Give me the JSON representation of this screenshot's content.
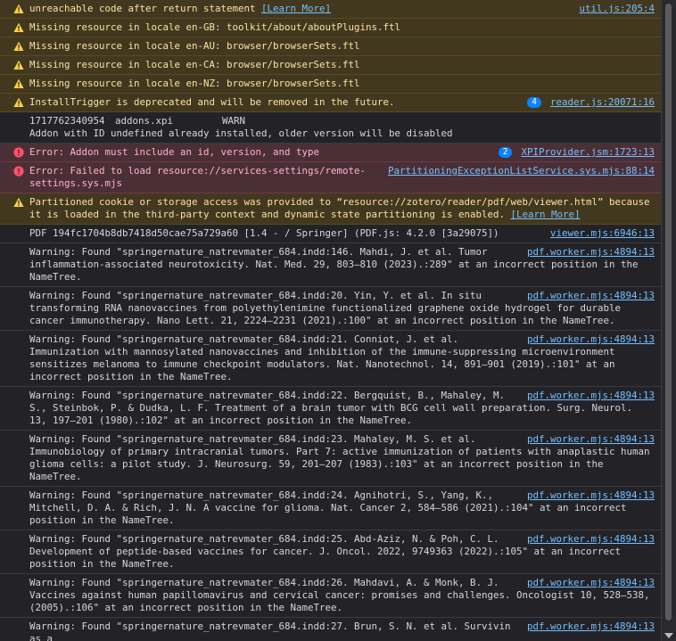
{
  "messages": [
    {
      "level": "warn",
      "text": "unreachable code after return statement",
      "link": "[Learn More]",
      "source": "util.js:205:4"
    },
    {
      "level": "warn",
      "text": "Missing resource in locale en-GB: toolkit/about/aboutPlugins.ftl"
    },
    {
      "level": "warn",
      "text": "Missing resource in locale en-AU: browser/browserSets.ftl"
    },
    {
      "level": "warn",
      "text": "Missing resource in locale en-CA: browser/browserSets.ftl"
    },
    {
      "level": "warn",
      "text": "Missing resource in locale en-NZ: browser/browserSets.ftl"
    },
    {
      "level": "warn",
      "text": "InstallTrigger is deprecated and will be removed in the future.",
      "badge": "4",
      "source": "reader.js:20071:16"
    },
    {
      "level": "log",
      "raw": true,
      "c1": "1717762340954",
      "c2": "addons.xpi",
      "c3": "WARN",
      "c4": "Addon with ID undefined already installed, older version will be disabled"
    },
    {
      "level": "error",
      "text": "Error: Addon must include an id, version, and type",
      "badge": "2",
      "source": "XPIProvider.jsm:1723:13"
    },
    {
      "level": "error",
      "text": "Error: Failed to load resource://services-settings/remote-settings.sys.mjs",
      "source": "PartitioningExceptionListService.sys.mjs:88:14"
    },
    {
      "level": "warn",
      "text": "Partitioned cookie or storage access was provided to “resource://zotero/reader/pdf/web/viewer.html” because it is loaded in the third-party context and dynamic state partitioning is enabled.",
      "link": "[Learn More]"
    },
    {
      "level": "log",
      "text": "PDF 194fc1704b8db7418d50cae75a729a60 [1.4 - / Springer] (PDF.js: 4.2.0 [3a29075])",
      "source": "viewer.mjs:6946:13"
    },
    {
      "level": "log",
      "text": "Warning: Found \"springernature_natrevmater_684.indd:146.        Mahdi, J. et al. Tumor inflammation-associated neurotoxicity. Nat. Med. 29, 803–810 (2023).:289\" at an incorrect position in the NameTree.",
      "source": "pdf.worker.mjs:4894:13"
    },
    {
      "level": "log",
      "text": "Warning: Found \"springernature_natrevmater_684.indd:20. Yin, Y. et al. In situ transforming RNA nanovaccines from polyethylenimine functionalized graphene oxide hydrogel for durable cancer immunotherapy. Nano Lett. 21, 2224–2231 (2021).:100\" at an incorrect position in the NameTree.",
      "source": "pdf.worker.mjs:4894:13"
    },
    {
      "level": "log",
      "text": "Warning: Found \"springernature_natrevmater_684.indd:21. Conniot, J. et al. Immunization with mannosylated nanovaccines and inhibition of the immune-suppressing microenvironment sensitizes melanoma to immune checkpoint modulators. Nat. Nanotechnol. 14, 891–901 (2019).:101\" at an incorrect position in the NameTree.",
      "source": "pdf.worker.mjs:4894:13"
    },
    {
      "level": "log",
      "text": "Warning: Found \"springernature_natrevmater_684.indd:22. Bergquist, B., Mahaley, M. S., Steinbok, P. & Dudka, L. F. Treatment of a brain tumor with BCG cell wall preparation. Surg. Neurol. 13, 197–201 (1980).:102\" at an incorrect position in the NameTree.",
      "source": "pdf.worker.mjs:4894:13"
    },
    {
      "level": "log",
      "text": "Warning: Found \"springernature_natrevmater_684.indd:23. Mahaley, M. S. et al. Immunobiology of primary intracranial tumors. Part 7: active immunization of patients with anaplastic human glioma cells: a pilot study. J. Neurosurg. 59, 201–207 (1983).:103\" at an incorrect position in the NameTree.",
      "source": "pdf.worker.mjs:4894:13"
    },
    {
      "level": "log",
      "text": "Warning: Found \"springernature_natrevmater_684.indd:24. Agnihotri, S., Yang, K., Mitchell, D. A. & Rich, J. N. A vaccine for glioma. Nat. Cancer 2, 584–586 (2021).:104\" at an incorrect position in the NameTree.",
      "source": "pdf.worker.mjs:4894:13"
    },
    {
      "level": "log",
      "text": "Warning: Found \"springernature_natrevmater_684.indd:25. Abd-Aziz, N. & Poh, C. L. Development of peptide-based vaccines for cancer. J. Oncol. 2022, 9749363 (2022).:105\" at an incorrect position in the NameTree.",
      "source": "pdf.worker.mjs:4894:13"
    },
    {
      "level": "log",
      "text": "Warning: Found \"springernature_natrevmater_684.indd:26. Mahdavi, A. & Monk, B. J. Vaccines against human papillomavirus and cervical cancer: promises and challenges. Oncologist 10, 528–538, (2005).:106\" at an incorrect position in the NameTree.",
      "source": "pdf.worker.mjs:4894:13"
    },
    {
      "level": "log",
      "text": "Warning: Found \"springernature_natrevmater_684.indd:27. Brun, S. N. et al. Survivin as a",
      "source": "pdf.worker.mjs:4894:13"
    }
  ],
  "colors": {
    "warn_bg": "#42381f",
    "error_bg": "#4b2f36",
    "link": "#75bfff",
    "badge": "#0a84ff"
  },
  "icons": {
    "warn": "warning-triangle-icon",
    "error": "error-circle-icon"
  }
}
